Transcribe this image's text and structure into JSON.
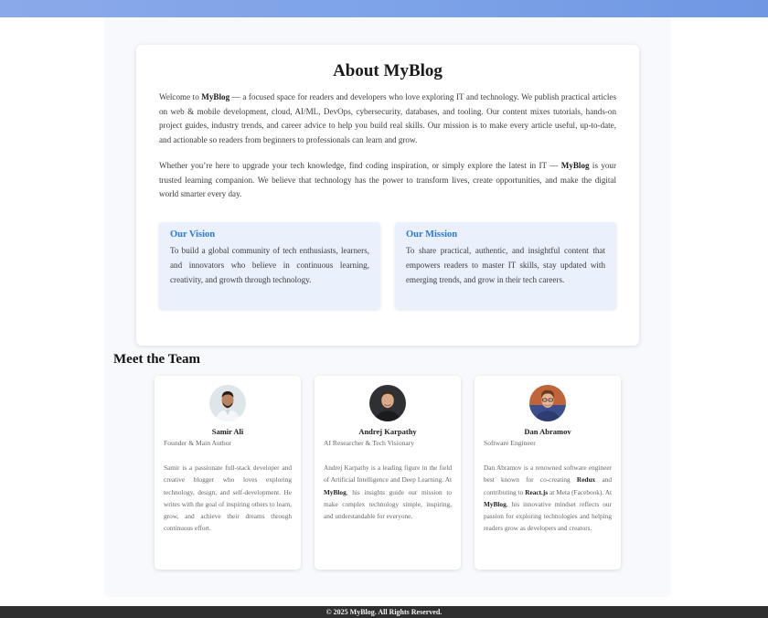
{
  "about": {
    "title": "About MyBlog",
    "p1_a": "Welcome to ",
    "p1_brand": "MyBlog",
    "p1_b": " — a focused space for readers and developers who love exploring IT and technology. We publish practical articles on web & mobile development, cloud, AI/ML, DevOps, cybersecurity, databases, and tooling. Our content mixes tutorials, hands-on project guides, industry trends, and career advice to help you build real skills. Our mission is to make every article useful, up-to-date, and actionable so readers from beginners to professionals can learn and grow.",
    "p2_a": "Whether you’re here to upgrade your tech knowledge, find coding inspiration, or simply explore the latest in IT — ",
    "p2_brand": "MyBlog",
    "p2_b": " is your trusted learning companion. We believe that technology has the power to transform lives, create opportunities, and make the digital world smarter every day.",
    "vision": {
      "title": "Our Vision",
      "text": "To build a global community of tech enthusiasts, learners, and innovators who believe in continuous learning, creativity, and growth through technology."
    },
    "mission": {
      "title": "Our Mission",
      "text": "To share practical, authentic, and insightful content that empowers readers to master IT skills, stay updated with emerging trends, and grow in their tech careers."
    }
  },
  "team": {
    "title": "Meet the Team",
    "members": [
      {
        "name": "Samir Ali",
        "role": "Founder & Main Author",
        "bio": "Samir is a passionate full-stack developer and creative blogger who loves exploring technology, design, and self-development. He writes with the goal of inspiring others to learn, grow, and achieve their dreams through continuous effort."
      },
      {
        "name": "Andrej Karpathy",
        "role": "AI Researcher & Tech Visionary",
        "bio_a": "Andrej Karpathy is a leading figure in the field of Artificial Intelligence and Deep Learning. At ",
        "bio_brand": "MyBlog",
        "bio_b": ", his insights guide our mission to make complex technology simple, inspiring, and understandable for everyone."
      },
      {
        "name": "Dan Abramov",
        "role": "Software Engineer",
        "bio_a": "Dan Abramov is a renowned software engineer best known for co-creating ",
        "bio_redux": "Redux",
        "bio_b": " and contributing to ",
        "bio_react": "React.js",
        "bio_c": " at Meta (Facebook). At ",
        "bio_brand": "MyBlog",
        "bio_d": ", his innovative mindset reflects our passion for exploring technologies and helping readers grow as developers and creators."
      }
    ]
  },
  "footer": {
    "text": "© 2025 MyBlog. All Rights Reserved."
  }
}
